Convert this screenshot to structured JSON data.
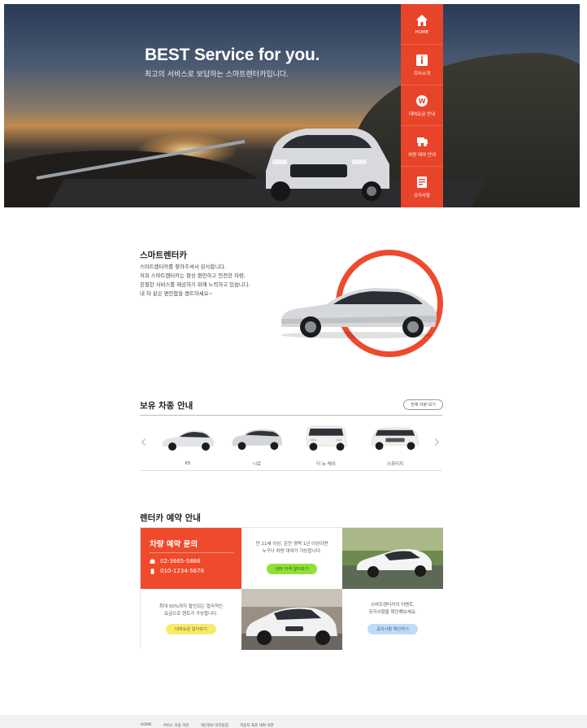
{
  "hero": {
    "title": "BEST Service for you.",
    "subtitle": "최고의 서비스로 보답하는 스마트렌터카입니다."
  },
  "nav": {
    "items": [
      {
        "label": "HOME",
        "icon": "home-icon"
      },
      {
        "label": "회사소개",
        "icon": "info-icon"
      },
      {
        "label": "대여요금 안내",
        "icon": "won-icon"
      },
      {
        "label": "차량 대여 안내",
        "icon": "car-rental-icon"
      },
      {
        "label": "공지사항",
        "icon": "notice-icon"
      }
    ],
    "color": "#e8442a"
  },
  "intro": {
    "title": "스마트렌터카",
    "lines": [
      "스마트렌터카를 찾아주셔서 감사합니다.",
      "저희 스마트렌터카는 항상 편안하고 안전한 차량,",
      "친절한 서비스를 제공하기 위해 노력하고 있습니다.",
      "내 차 같은 편안함을 렌트하세요~"
    ]
  },
  "vehicles": {
    "title": "보유 차종 안내",
    "view_all": "전체 차량 보기",
    "prev_arrow": "‹",
    "next_arrow": "›",
    "items": [
      {
        "name": "K5",
        "color": "#e8e8ea"
      },
      {
        "name": "니로",
        "color": "#d9d9d9"
      },
      {
        "name": "더 뉴 레이",
        "color": "#f2f2f2"
      },
      {
        "name": "스포티지",
        "color": "#f0f0f0"
      }
    ]
  },
  "reservation": {
    "title": "렌터카 예약 안내",
    "inquiry": {
      "title": "차량 예약 문의",
      "phone": "02-3665-5886",
      "mobile": "010-1234-5678"
    },
    "age": {
      "text1": "만 21세 이상, 운전 경력 1년 이상이면",
      "text2": "누구나 차량 대여가 가능합니다.",
      "button": "대여 자격 알아보기"
    },
    "discount": {
      "text1": "최대 50%까지 할인되는 합리적인",
      "text2": "요금으로 렌트가 가능합니다.",
      "button": "대여요금 알아보기"
    },
    "event": {
      "text1": "스마트렌터카의 이벤트,",
      "text2": "공지사항을 확인해보세요.",
      "button": "공지사항 확인하기"
    },
    "accent": "#ef4a2c"
  },
  "footer": {
    "links": [
      "HOME",
      "서비스 이용 약관",
      "개인정보 처리방침",
      "자동차 표준 대여 약관"
    ]
  }
}
